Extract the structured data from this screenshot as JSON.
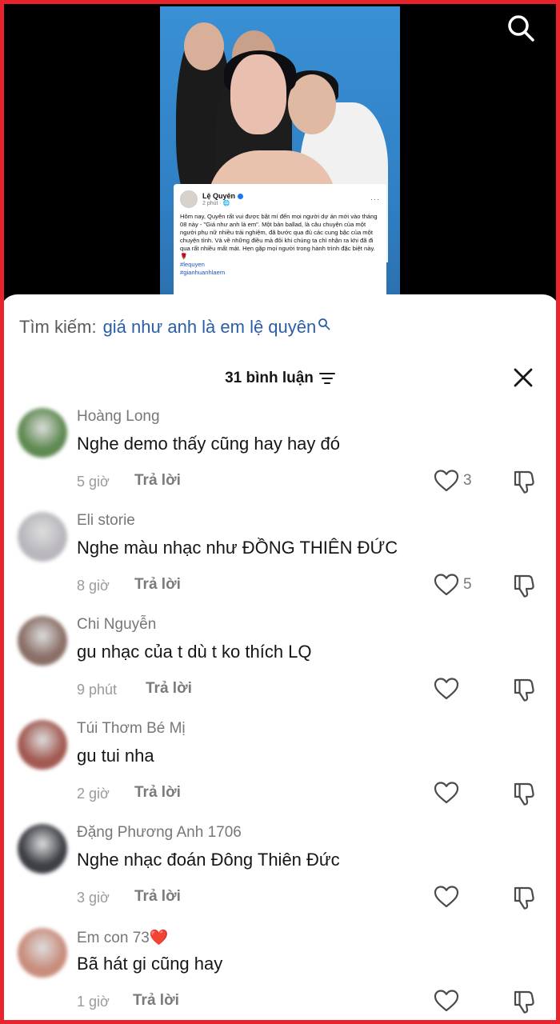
{
  "video": {
    "post": {
      "author": "Lệ Quyên",
      "time": "2 phút · 🌐",
      "more": "···",
      "text": "Hôm nay, Quyên rất vui được bật mí đến mọi người dự án mới vào tháng 08 này - \"Giá như anh là em\". Một bản ballad, là câu chuyện của một người phụ nữ nhiều trải nghiệm, đã bước qua đủ các cung bậc của một chuyện tình. Và về những điều mà đôi khi chúng ta chỉ nhận ra khi đã đi qua rất nhiều mất mát. Hẹn gặp mọi người trong hành trình đặc biệt này. 🌹",
      "tags": [
        "#lequyen",
        "#gianhuanhlaem"
      ]
    }
  },
  "search": {
    "prefix": "Tìm kiếm:",
    "query": "giá như anh là em lệ quyên"
  },
  "header": {
    "comment_count": "31 bình luận"
  },
  "reply_label": "Trả lời",
  "comments": [
    {
      "user": "Hoàng Long",
      "emoji": "",
      "text": "Nghe demo thấy cũng hay hay đó",
      "time": "5 giờ",
      "likes": "3",
      "avatar_color": "#5f8a52"
    },
    {
      "user": "Eli storie",
      "emoji": "",
      "text": "Nghe màu nhạc như ĐỒNG THIÊN ĐỨC",
      "time": "8 giờ",
      "likes": "5",
      "avatar_color": "#b9b7bd"
    },
    {
      "user": "Chi Nguyễn",
      "emoji": "",
      "text": "gu nhạc của t dù t ko thích LQ",
      "time": "9 phút",
      "likes": "",
      "avatar_color": "#8a6f66"
    },
    {
      "user": "Túi Thơm Bé Mị",
      "emoji": "",
      "text": "gu tui nha",
      "time": "2 giờ",
      "likes": "",
      "avatar_color": "#a25a52"
    },
    {
      "user": "Đặng Phương Anh 1706",
      "emoji": "",
      "text": "Nghe nhạc đoán Đông Thiên Đức",
      "time": "3 giờ",
      "likes": "",
      "avatar_color": "#3d3f45"
    },
    {
      "user": "Em con 73",
      "emoji": "❤️",
      "text": "Bã hát gi cũng hay",
      "time": "1 giờ",
      "likes": "",
      "avatar_color": "#c98d7d"
    }
  ]
}
